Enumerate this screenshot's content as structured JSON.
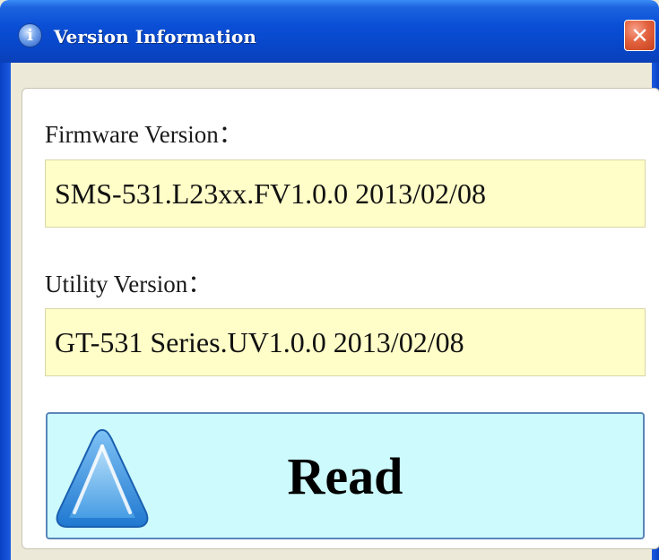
{
  "window": {
    "title": "Version Information",
    "title_icon_glyph": "i",
    "close_glyph": "✕"
  },
  "firmware": {
    "label": "Firmware Version：",
    "value": "SMS-531.L23xx.FV1.0.0 2013/02/08"
  },
  "utility": {
    "label": "Utility Version：",
    "value": "GT-531 Series.UV1.0.0 2013/02/08"
  },
  "read_button": {
    "label": "Read",
    "icon": "triangle-up-icon"
  },
  "colors": {
    "titlebar": "#0a4fd6",
    "field_background": "#fffdc8",
    "button_background": "#ccfafd",
    "close_button": "#e3623e"
  }
}
